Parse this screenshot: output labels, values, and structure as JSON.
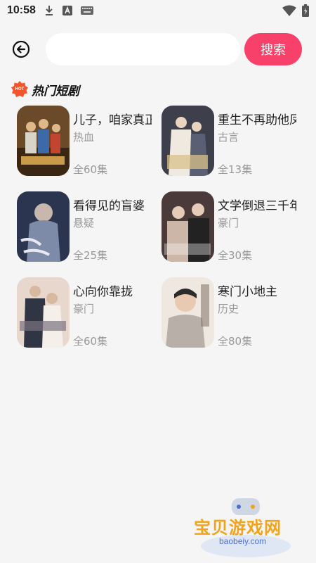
{
  "status": {
    "time": "10:58",
    "icons": [
      "download-icon",
      "a-icon",
      "keyboard-icon",
      "wifi-icon",
      "battery-icon"
    ]
  },
  "search": {
    "placeholder": "",
    "value": "",
    "button_label": "搜索"
  },
  "section": {
    "badge": "HOT",
    "title": "热门短剧"
  },
  "dramas": [
    {
      "title": "儿子，咱家真正",
      "genre": "热血",
      "episodes": "全60集",
      "cover_colors": [
        "#6b4a2a",
        "#c99a4a"
      ]
    },
    {
      "title": "重生不再助他凤",
      "genre": "古言",
      "episodes": "全13集",
      "cover_colors": [
        "#3d3f4a",
        "#d8c08a"
      ]
    },
    {
      "title": "看得见的盲婆",
      "genre": "悬疑",
      "episodes": "全25集",
      "cover_colors": [
        "#2b3550",
        "#7d8aa8"
      ]
    },
    {
      "title": "文学倒退三千年",
      "genre": "豪门",
      "episodes": "全30集",
      "cover_colors": [
        "#4a3a3a",
        "#cbb6a8"
      ]
    },
    {
      "title": "心向你靠拢",
      "genre": "豪门",
      "episodes": "全60集",
      "cover_colors": [
        "#7a7480",
        "#e7d7cc"
      ]
    },
    {
      "title": "寒门小地主",
      "genre": "历史",
      "episodes": "全80集",
      "cover_colors": [
        "#b8b0a8",
        "#efe8e0"
      ]
    }
  ],
  "watermark": {
    "title": "宝贝游戏网",
    "url": "baobeiy.com"
  },
  "colors": {
    "accent": "#f7416a",
    "hot": "#f2552c",
    "background": "#f5f5f5"
  }
}
